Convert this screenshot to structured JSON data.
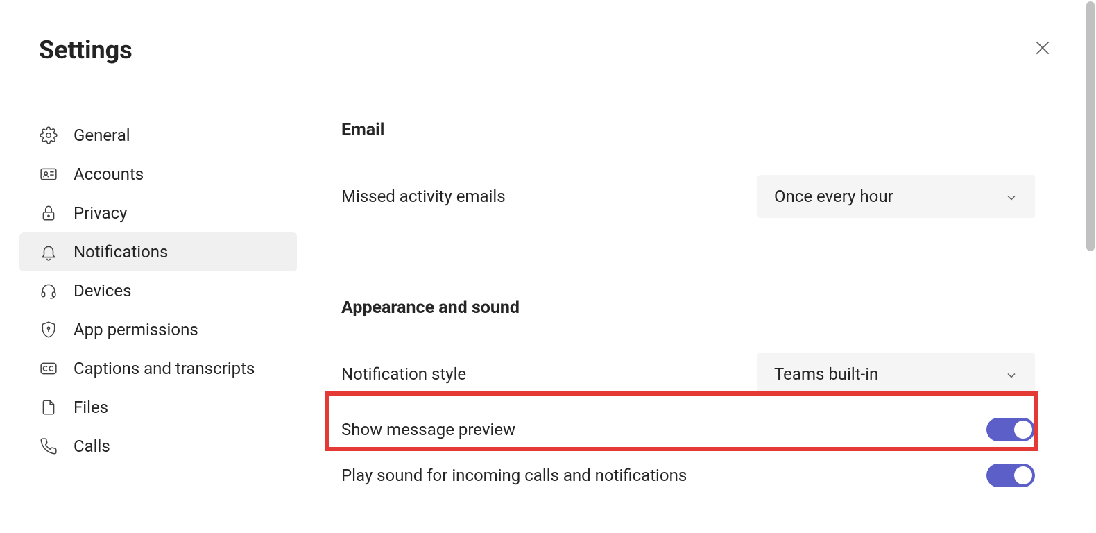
{
  "header": {
    "title": "Settings"
  },
  "sidebar": {
    "items": [
      {
        "label": "General",
        "icon": "gear-icon"
      },
      {
        "label": "Accounts",
        "icon": "id-card-icon"
      },
      {
        "label": "Privacy",
        "icon": "lock-icon"
      },
      {
        "label": "Notifications",
        "icon": "bell-icon",
        "active": true
      },
      {
        "label": "Devices",
        "icon": "headset-icon"
      },
      {
        "label": "App permissions",
        "icon": "shield-key-icon"
      },
      {
        "label": "Captions and transcripts",
        "icon": "cc-icon"
      },
      {
        "label": "Files",
        "icon": "file-icon"
      },
      {
        "label": "Calls",
        "icon": "phone-icon"
      }
    ]
  },
  "sections": {
    "email": {
      "title": "Email",
      "missed_label": "Missed activity emails",
      "missed_value": "Once every hour"
    },
    "appearance": {
      "title": "Appearance and sound",
      "style_label": "Notification style",
      "style_value": "Teams built-in",
      "preview_label": "Show message preview",
      "preview_on": true,
      "sound_label": "Play sound for incoming calls and notifications",
      "sound_on": true
    }
  },
  "colors": {
    "toggle_on": "#5b5fc7",
    "highlight": "#e53935"
  }
}
